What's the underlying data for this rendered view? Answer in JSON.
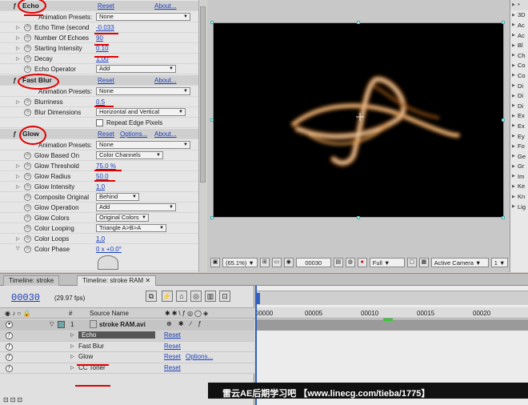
{
  "effects_panel": {
    "echo": {
      "name": "Echo",
      "reset": "Reset",
      "about": "About...",
      "presets_label": "Animation Presets:",
      "presets_value": "None",
      "params": [
        {
          "label": "Echo Time (second",
          "value": "-0.033"
        },
        {
          "label": "Number Of Echoes",
          "value": "90"
        },
        {
          "label": "Starting Intensity",
          "value": "0.10"
        },
        {
          "label": "Decay",
          "value": "1.00"
        }
      ],
      "operator_label": "Echo Operator",
      "operator_value": "Add"
    },
    "fast_blur": {
      "name": "Fast Blur",
      "reset": "Reset",
      "about": "About...",
      "presets_label": "Animation Presets:",
      "presets_value": "None",
      "blurriness_label": "Blurriness",
      "blurriness_value": "0.5",
      "dimensions_label": "Blur Dimensions",
      "dimensions_value": "Horizontal and Vertical",
      "repeat_label": "Repeat Edge Pixels"
    },
    "glow": {
      "name": "Glow",
      "reset": "Reset",
      "options": "Options...",
      "about": "About...",
      "presets_label": "Animation Presets:",
      "presets_value": "None",
      "based_on_label": "Glow Based On",
      "based_on_value": "Color Channels",
      "threshold_label": "Glow Threshold",
      "threshold_value": "75.0 %",
      "radius_label": "Glow Radius",
      "radius_value": "50.0",
      "intensity_label": "Glow Intensity",
      "intensity_value": "1.0",
      "composite_label": "Composite Original",
      "composite_value": "Behind",
      "operation_label": "Glow Operation",
      "operation_value": "Add",
      "colors_label": "Glow Colors",
      "colors_value": "Original Colors",
      "looping_label": "Color Looping",
      "looping_value": "Triangle A>B>A",
      "loops_label": "Color Loops",
      "loops_value": "1.0",
      "phase_label": "Color Phase",
      "phase_value": "0 x +0.0°"
    }
  },
  "comp_toolbar": {
    "zoom": "(65.1%)",
    "timecode": "00030",
    "resolution": "Full",
    "camera": "Active Camera",
    "views": "1"
  },
  "right_panel": {
    "items": [
      "*",
      "3D",
      "Ac",
      "Ac",
      "Bl",
      "Ch",
      "Co",
      "Co",
      "Di",
      "Di",
      "Di",
      "Ex",
      "Ex",
      "Ey",
      "Fo",
      "Ge",
      "Gr",
      "Im",
      "Ke",
      "Kn",
      "Lig"
    ]
  },
  "timeline": {
    "tabs": [
      "Timeline: stroke",
      "Timeline: stroke RAM"
    ],
    "current_time": "00030",
    "fps": "(29.97 fps)",
    "col_source_name": "Source Name",
    "ruler_ticks": [
      "00000",
      "00005",
      "00010",
      "00015",
      "00020"
    ],
    "layer": {
      "number": "1",
      "name": "stroke RAM.avi"
    },
    "effects": [
      {
        "name": "Echo",
        "reset": "Reset",
        "options": ""
      },
      {
        "name": "Fast Blur",
        "reset": "Reset",
        "options": ""
      },
      {
        "name": "Glow",
        "reset": "Reset",
        "options": "Options..."
      },
      {
        "name": "CC Toner",
        "reset": "Reset",
        "options": ""
      }
    ]
  },
  "watermark": "雷云AE后期学习吧 【www.linecg.com/tieba/1775】"
}
